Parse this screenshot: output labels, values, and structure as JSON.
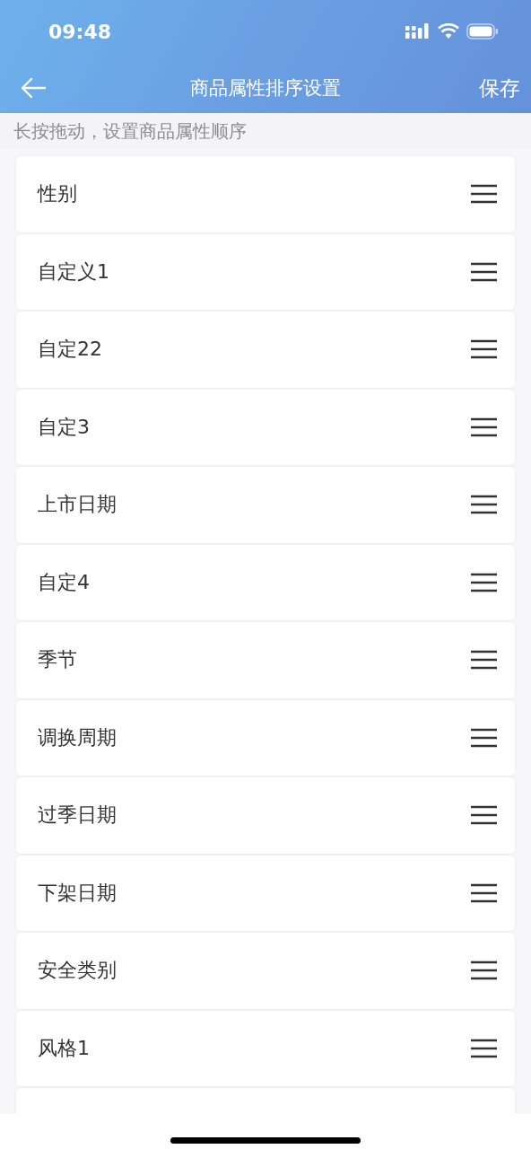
{
  "status_bar": {
    "time": "09:48"
  },
  "nav_bar": {
    "title": "商品属性排序设置",
    "action": "保存"
  },
  "hint": "长按拖动，设置商品属性顺序",
  "attributes": [
    {
      "name": "性别"
    },
    {
      "name": "自定义1"
    },
    {
      "name": "自定22"
    },
    {
      "name": "自定3"
    },
    {
      "name": "上市日期"
    },
    {
      "name": "自定4"
    },
    {
      "name": "季节"
    },
    {
      "name": "调换周期"
    },
    {
      "name": "过季日期"
    },
    {
      "name": "下架日期"
    },
    {
      "name": "安全类别"
    },
    {
      "name": "风格1"
    }
  ]
}
